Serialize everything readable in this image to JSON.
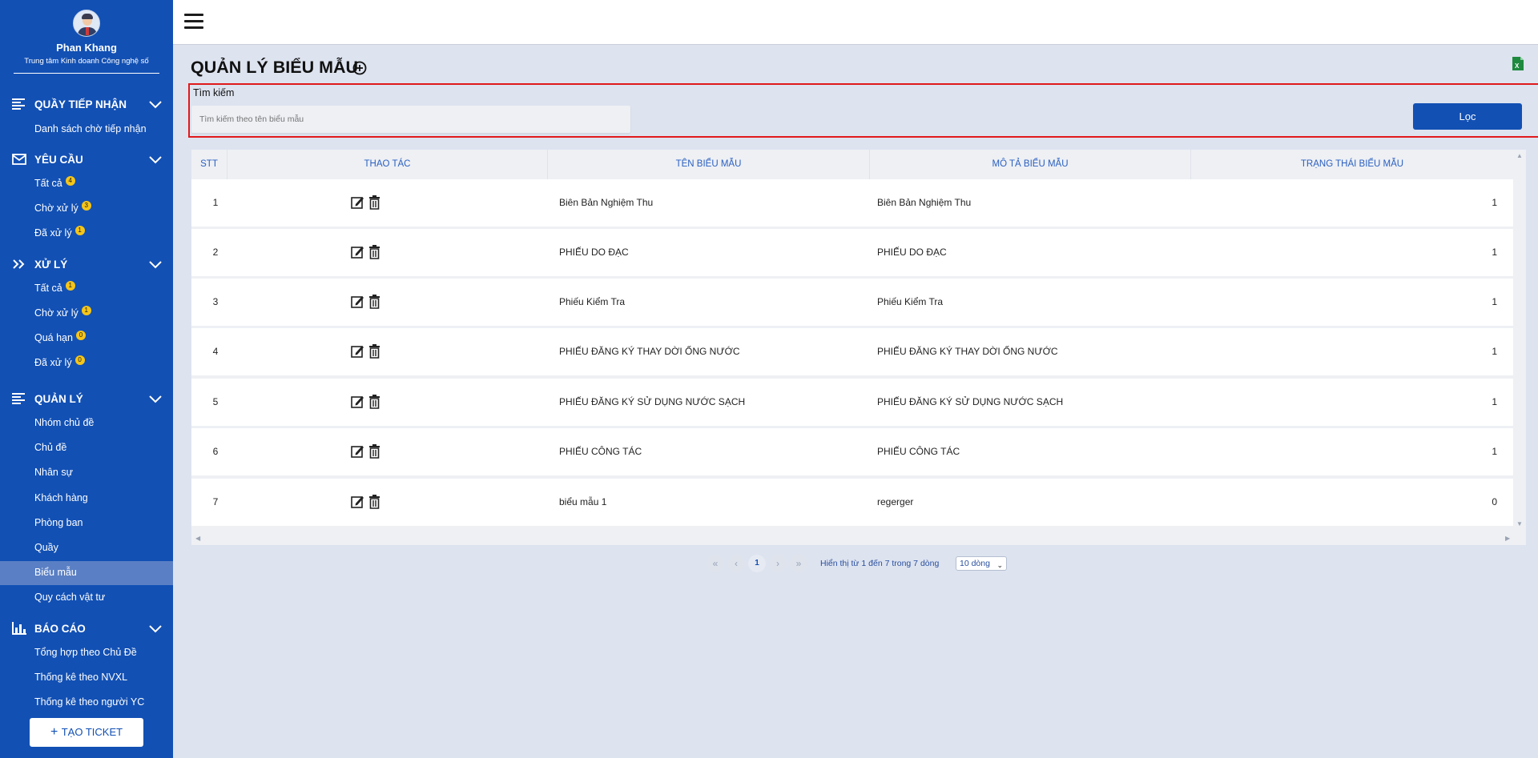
{
  "user": {
    "name": "Phan Khang",
    "unit": "Trung tâm Kinh doanh Công nghệ số"
  },
  "sidebar": {
    "sections": [
      {
        "title": "QUẦY TIẾP NHẬN",
        "icon": "list-icon"
      },
      {
        "title": "YÊU CẦU",
        "icon": "mail-icon"
      },
      {
        "title": "XỬ LÝ",
        "icon": "double-chevron-right-icon"
      },
      {
        "title": "QUẢN LÝ",
        "icon": "list-icon"
      },
      {
        "title": "BÁO CÁO",
        "icon": "bar-chart-icon"
      }
    ],
    "items": [
      {
        "label": "Danh sách chờ tiếp nhận"
      },
      {
        "label": "Tất cả",
        "badge": "4"
      },
      {
        "label": "Chờ xử lý",
        "badge": "3"
      },
      {
        "label": "Đã xử lý",
        "badge": "1"
      },
      {
        "label": "Tất cả",
        "badge": "1"
      },
      {
        "label": "Chờ xử lý",
        "badge": "1"
      },
      {
        "label": "Quá hạn",
        "badge": "0"
      },
      {
        "label": "Đã xử lý",
        "badge": "0"
      },
      {
        "label": "Nhóm chủ đề"
      },
      {
        "label": "Chủ đề"
      },
      {
        "label": "Nhân sự"
      },
      {
        "label": "Khách hàng"
      },
      {
        "label": "Phòng ban"
      },
      {
        "label": "Quầy"
      },
      {
        "label": "Biểu mẫu"
      },
      {
        "label": "Quy cách vật tư"
      },
      {
        "label": "Tổng hợp theo Chủ Đề"
      },
      {
        "label": "Thống kê theo NVXL"
      },
      {
        "label": "Thống kê theo người YC"
      }
    ],
    "create_ticket": "TẠO TICKET"
  },
  "page": {
    "title": "QUẢN LÝ BIỂU MẪU"
  },
  "search": {
    "label": "Tìm kiếm",
    "placeholder": "Tìm kiếm theo tên biểu mẫu",
    "filter_label": "Lọc"
  },
  "table": {
    "headers": [
      "STT",
      "THAO TÁC",
      "TÊN BIỂU MẪU",
      "MÔ TẢ BIỂU MẪU",
      "TRẠNG THÁI BIỂU MẪU"
    ],
    "rows": [
      {
        "stt": "1",
        "name": "Biên Bản Nghiệm Thu",
        "desc": "Biên Bản Nghiệm Thu",
        "status": "1"
      },
      {
        "stt": "2",
        "name": "PHIẾU DO ĐẠC",
        "desc": "PHIẾU DO ĐẠC",
        "status": "1"
      },
      {
        "stt": "3",
        "name": "Phiếu Kiểm Tra",
        "desc": "Phiếu Kiểm Tra",
        "status": "1"
      },
      {
        "stt": "4",
        "name": "PHIẾU ĐĂNG KÝ THAY DỜI ỐNG NƯỚC",
        "desc": "PHIẾU ĐĂNG KÝ THAY DỜI ỐNG NƯỚC",
        "status": "1"
      },
      {
        "stt": "5",
        "name": "PHIẾU ĐĂNG KÝ SỬ DỤNG NƯỚC SẠCH",
        "desc": "PHIẾU ĐĂNG KÝ SỬ DỤNG NƯỚC SẠCH",
        "status": "1"
      },
      {
        "stt": "6",
        "name": "PHIẾU CÔNG TÁC",
        "desc": "PHIẾU CÔNG TÁC",
        "status": "1"
      },
      {
        "stt": "7",
        "name": "biểu mẫu 1",
        "desc": "regerger",
        "status": "0"
      }
    ]
  },
  "pagination": {
    "first": "«",
    "prev": "‹",
    "current": "1",
    "next": "›",
    "last": "»",
    "info": "Hiển thị từ 1 đến 7 trong 7 dòng",
    "page_size": "10 dòng"
  },
  "colors": {
    "sidebar": "#1250b4",
    "accent": "#1250b4",
    "header_text": "#2a5fc0",
    "badge": "#f5c518",
    "highlight": "#e0191b"
  }
}
